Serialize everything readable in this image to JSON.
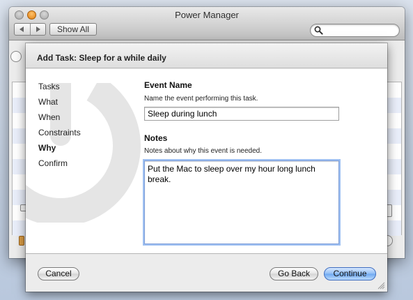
{
  "window": {
    "title": "Power Manager",
    "show_all_label": "Show All",
    "back_icon": "triangle-left",
    "forward_icon": "triangle-right",
    "search": {
      "value": "",
      "icon": "magnifier"
    }
  },
  "sheet": {
    "title": "Add Task: Sleep for a while daily",
    "steps": [
      {
        "label": "Tasks",
        "current": false
      },
      {
        "label": "What",
        "current": false
      },
      {
        "label": "When",
        "current": false
      },
      {
        "label": "Constraints",
        "current": false
      },
      {
        "label": "Why",
        "current": true
      },
      {
        "label": "Confirm",
        "current": false
      }
    ],
    "event_name": {
      "heading": "Event Name",
      "description": "Name the event performing this task.",
      "value": "Sleep during lunch"
    },
    "notes": {
      "heading": "Notes",
      "description": "Notes about why this event is needed.",
      "value": "Put the Mac to sleep over my hour long lunch break."
    },
    "buttons": {
      "cancel": "Cancel",
      "go_back": "Go Back",
      "continue": "Continue"
    }
  },
  "colors": {
    "accent": "#6ea8f1",
    "focus_ring": "#9ec0f2",
    "minimize_light": "#e07e10"
  }
}
